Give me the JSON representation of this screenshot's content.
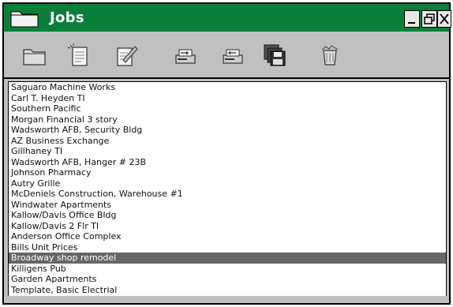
{
  "window": {
    "title": "Jobs",
    "controls": {
      "minimize": "_",
      "restore": "⧉",
      "close": "X"
    }
  },
  "toolbar": {
    "buttons": [
      {
        "name": "open-folder",
        "icon": "folder-icon"
      },
      {
        "name": "new-document",
        "icon": "new-document-icon"
      },
      {
        "name": "edit-document",
        "icon": "edit-document-icon"
      },
      {
        "name": "export",
        "icon": "export-icon"
      },
      {
        "name": "import",
        "icon": "import-icon"
      },
      {
        "name": "save",
        "icon": "floppy-disk-icon"
      },
      {
        "name": "delete",
        "icon": "trash-icon"
      }
    ]
  },
  "jobs": {
    "selected_index": 19,
    "items": [
      "Saguaro Machine Works",
      "Carl T. Heyden TI",
      "Southern Pacific",
      "Morgan Financial 3 story",
      "Wadsworth AFB, Security Bldg",
      "AZ Business Exchange",
      "Gillhaney TI",
      "Wadsworth AFB, Hanger # 23B",
      "Johnson Pharmacy",
      "Autry Grille",
      "McDeniels Construction, Warehouse #1",
      "Windwater Apartments",
      "Kallow/Davis Office Bldg",
      "Kallow/Davis 2 Flr TI",
      "Anderson Office Complex",
      "Bills Unit Prices",
      "Broadway shop remodel",
      "Killigens Pub",
      "Garden Apartments",
      "Template, Basic Electrial"
    ]
  },
  "colors": {
    "titlebar": "#0a7f3a",
    "selection": "#666666",
    "chrome": "#c0c0c0"
  }
}
